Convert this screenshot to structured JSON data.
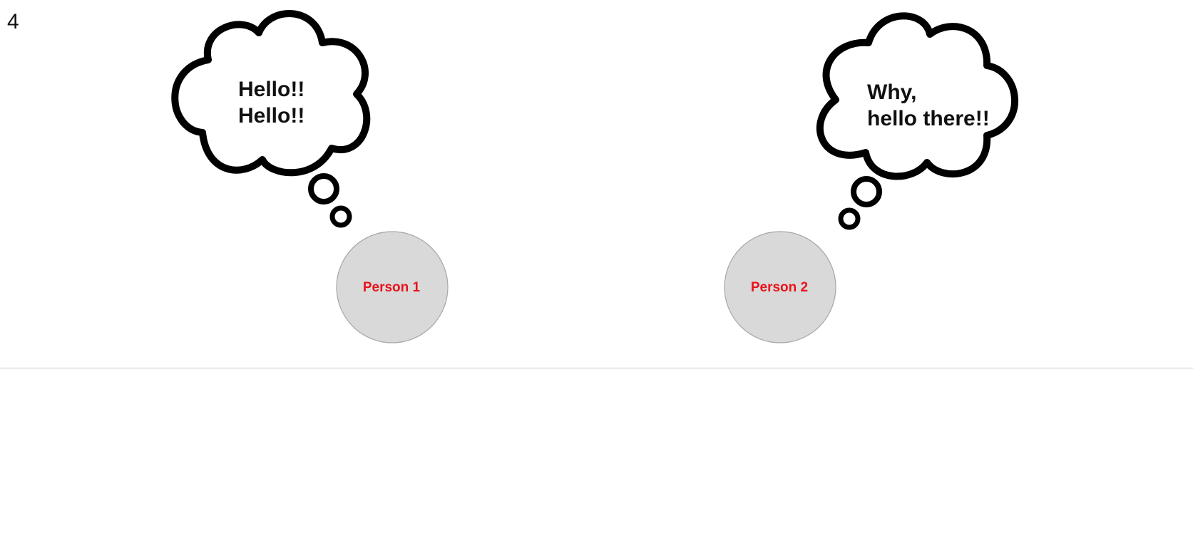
{
  "slide": {
    "page_number": "4"
  },
  "persons": [
    {
      "label": "Person 1"
    },
    {
      "label": "Person 2"
    }
  ],
  "thoughts": [
    {
      "line1": "Hello!!",
      "line2": "Hello!!"
    },
    {
      "line1": "Why,",
      "line2": "hello there!!"
    }
  ],
  "colors": {
    "person_fill": "#d9d9d9",
    "person_stroke": "#a6a6a6",
    "person_label": "#e8141c",
    "cloud_stroke": "#000000",
    "divider": "#c8c8c8"
  }
}
